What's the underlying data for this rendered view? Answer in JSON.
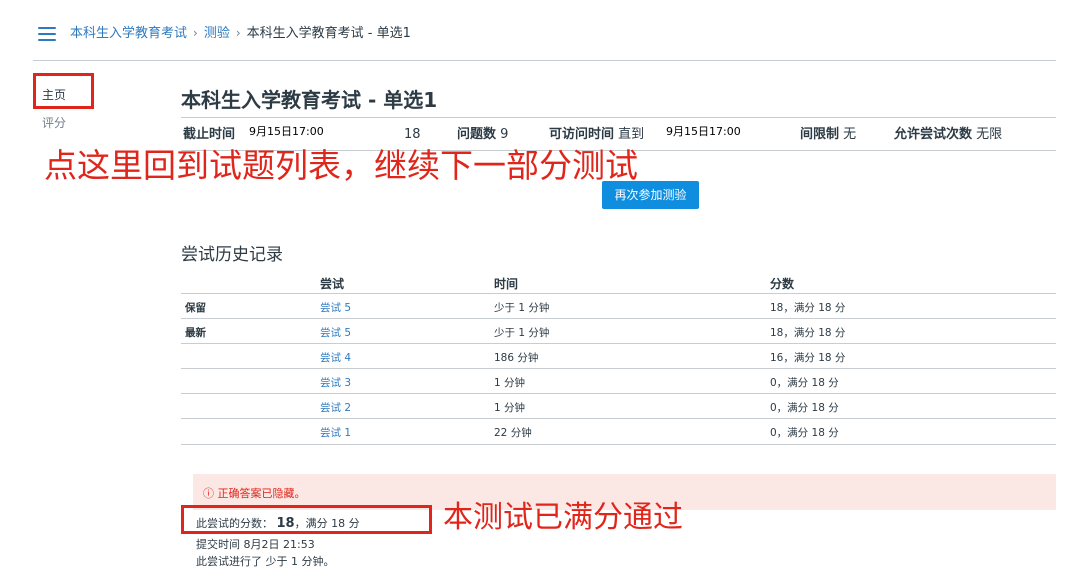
{
  "header": {
    "menu_icon": "hamburger-menu-icon",
    "breadcrumbs": [
      "本科生入学教育考试",
      "测验",
      "本科生入学教育考试 - 单选1"
    ],
    "separator": "›"
  },
  "sidebar": {
    "home": "主页",
    "grades": "评分"
  },
  "quiz": {
    "title": "本科生入学教育考试 - 单选1",
    "due_label": "截止时间",
    "due_value": "9月15日17:00",
    "points_value": "18",
    "questions_label": "问题数",
    "questions_value": "9",
    "available_label": "可访问时间",
    "available_value": "直到",
    "available_date": "9月15日17:00",
    "time_limit_label": "间限制",
    "time_limit_value": "无",
    "attempts_label": "允许尝试次数",
    "attempts_value": "无限",
    "retake_button": "再次参加测验"
  },
  "annotations": {
    "top": "点这里回到试题列表，继续下一部分测试",
    "bottom": "本测试已满分通过"
  },
  "history": {
    "title": "尝试历史记录",
    "headers": {
      "attempt": "尝试",
      "time": "时间",
      "score": "分数"
    },
    "rows": [
      {
        "label": "保留",
        "attempt": "尝试 5",
        "time": "少于 1 分钟",
        "score": "18，满分 18 分"
      },
      {
        "label": "最新",
        "attempt": "尝试 5",
        "time": "少于 1 分钟",
        "score": "18，满分 18 分"
      },
      {
        "label": "",
        "attempt": "尝试 4",
        "time": "186 分钟",
        "score": "16，满分 18 分"
      },
      {
        "label": "",
        "attempt": "尝试 3",
        "time": "1 分钟",
        "score": "0，满分 18 分"
      },
      {
        "label": "",
        "attempt": "尝试 2",
        "time": "1 分钟",
        "score": "0，满分 18 分"
      },
      {
        "label": "",
        "attempt": "尝试 1",
        "time": "22 分钟",
        "score": "0，满分 18 分"
      }
    ]
  },
  "result": {
    "alert_icon": "info-circle-icon",
    "alert": "正确答案已隐藏。",
    "score_label": "此尝试的分数：",
    "score_value": "18",
    "score_total": "，满分 18 分",
    "submitted": "提交时间 8月2日 21:53",
    "duration": "此尝试进行了 少于 1 分钟。"
  },
  "colors": {
    "link": "#2d7ac0",
    "button": "#0f8ee0",
    "annotation": "#e0251b",
    "alert_bg": "#fbe8e5"
  }
}
